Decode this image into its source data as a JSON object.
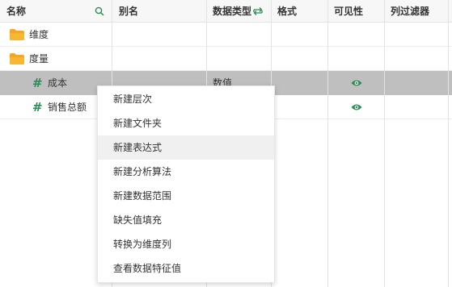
{
  "columns": [
    {
      "label": "名称"
    },
    {
      "label": "别名"
    },
    {
      "label": "数据类型"
    },
    {
      "label": "格式"
    },
    {
      "label": "可见性"
    },
    {
      "label": "列过滤器"
    }
  ],
  "icons": {
    "search": "search-icon",
    "swap": "swap-icon",
    "folder": "folder-icon",
    "measure": "hash-icon",
    "visible": "eye-icon"
  },
  "colors": {
    "folder": "#f5a623",
    "accent": "#2e8b57",
    "selected_row": "#bfbfbf"
  },
  "rows": [
    {
      "name": "维度",
      "type": "folder"
    },
    {
      "name": "度量",
      "type": "folder"
    },
    {
      "name": "成本",
      "type": "measure",
      "data_type": "数值",
      "visible": true,
      "selected": true
    },
    {
      "name": "销售总额",
      "type": "measure",
      "visible": true
    }
  ],
  "context_menu": {
    "items": [
      {
        "label": "新建层次"
      },
      {
        "label": "新建文件夹"
      },
      {
        "label": "新建表达式",
        "hovered": true
      },
      {
        "label": "新建分析算法"
      },
      {
        "label": "新建数据范围"
      },
      {
        "label": "缺失值填充"
      },
      {
        "label": "转换为维度列"
      },
      {
        "label": "查看数据特征值"
      }
    ]
  }
}
